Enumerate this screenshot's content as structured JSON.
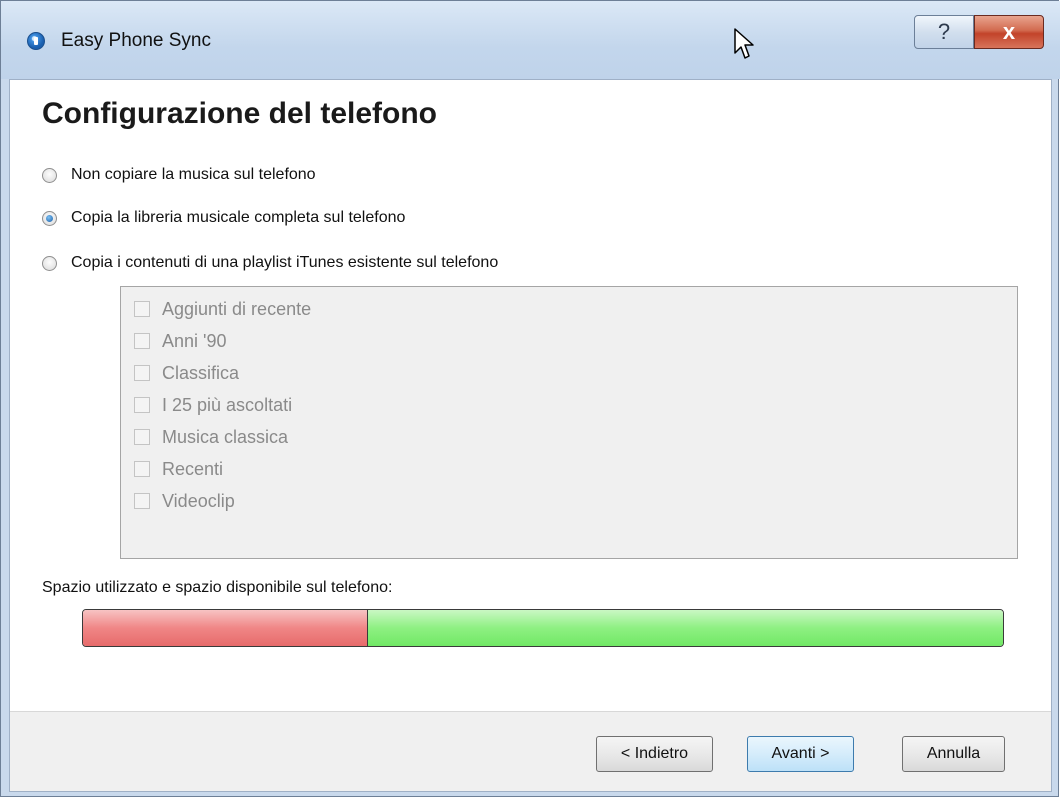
{
  "window": {
    "title": "Easy Phone Sync",
    "help_label": "?",
    "close_label": "x"
  },
  "page": {
    "heading": "Configurazione del telefono"
  },
  "options": [
    {
      "label": "Non copiare la musica sul telefono",
      "selected": false
    },
    {
      "label": "Copia la libreria musicale completa sul telefono",
      "selected": true
    },
    {
      "label": "Copia i contenuti di una playlist iTunes esistente sul telefono",
      "selected": false
    }
  ],
  "playlists": [
    {
      "label": "Aggiunti di recente",
      "checked": false
    },
    {
      "label": "Anni '90",
      "checked": false
    },
    {
      "label": "Classifica",
      "checked": false
    },
    {
      "label": "I 25 più ascoltati",
      "checked": false
    },
    {
      "label": "Musica classica",
      "checked": false
    },
    {
      "label": "Recenti",
      "checked": false
    },
    {
      "label": "Videoclip",
      "checked": false
    }
  ],
  "storage": {
    "label": "Spazio utilizzato e spazio disponibile sul telefono:",
    "used_fraction": 0.31,
    "used_color": "#f08686",
    "free_color": "#8ef082"
  },
  "buttons": {
    "back": "< Indietro",
    "next": "Avanti >",
    "cancel": "Annulla"
  }
}
